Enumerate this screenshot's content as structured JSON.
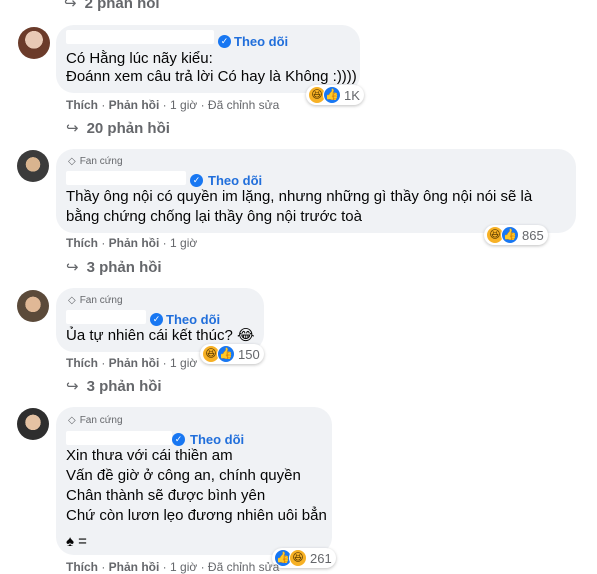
{
  "colors": {
    "bubble": "#f0f2f5",
    "link_blue": "#216fdb",
    "meta_gray": "#65676b",
    "haha_yellow": "#f7b125",
    "like_blue": "#1877f2"
  },
  "top_replies_label": "2 phản hồi",
  "comments": [
    {
      "avatar_icon": "user-avatar",
      "name_prefix": "",
      "follow": "Theo dõi",
      "badge": "",
      "lines": [
        "Có Hằng lúc nãy kiểu:",
        "Đoánn xem câu trả lời Có hay là Không :))))"
      ],
      "actions": {
        "like": "Thích",
        "reply": "Phản hồi",
        "time": "1 giờ",
        "edited": "Đã chỉnh sửa"
      },
      "reaction_count": "1K",
      "replies_label": "20 phản hồi"
    },
    {
      "avatar_icon": "user-avatar",
      "name_prefix": "",
      "follow": "Theo dõi",
      "badge": "Fan cứng",
      "lines": [
        "Thầy ông nội có quyền im lặng, nhưng những gì thầy ông nội nói sẽ là",
        "bằng chứng chống lại thầy ông nội trước toà"
      ],
      "actions": {
        "like": "Thích",
        "reply": "Phản hồi",
        "time": "1 giờ",
        "edited": ""
      },
      "reaction_count": "865",
      "replies_label": "3 phản hồi"
    },
    {
      "avatar_icon": "user-avatar",
      "name_prefix": "",
      "follow": "Theo dõi",
      "badge": "Fan cứng",
      "lines": [
        "Ủa tự nhiên cái kết thúc? 😂"
      ],
      "actions": {
        "like": "Thích",
        "reply": "Phản hồi",
        "time": "1 giờ",
        "edited": ""
      },
      "reaction_count": "150",
      "replies_label": "3 phản hồi"
    },
    {
      "avatar_icon": "user-avatar",
      "name_prefix": "",
      "follow": "Theo dõi",
      "badge": "Fan cứng",
      "lines": [
        "Xin thưa với cái thiền am",
        "Vấn đề giờ ở công an, chính quyền",
        "Chân thành sẽ được bình yên",
        "Chứ còn lươn lẹo đương nhiên uôi bẳn",
        "♠ ="
      ],
      "actions": {
        "like": "Thích",
        "reply": "Phản hồi",
        "time": "1 giờ",
        "edited": "Đã chỉnh sửa"
      },
      "reaction_count": "261",
      "replies_label": ""
    }
  ]
}
